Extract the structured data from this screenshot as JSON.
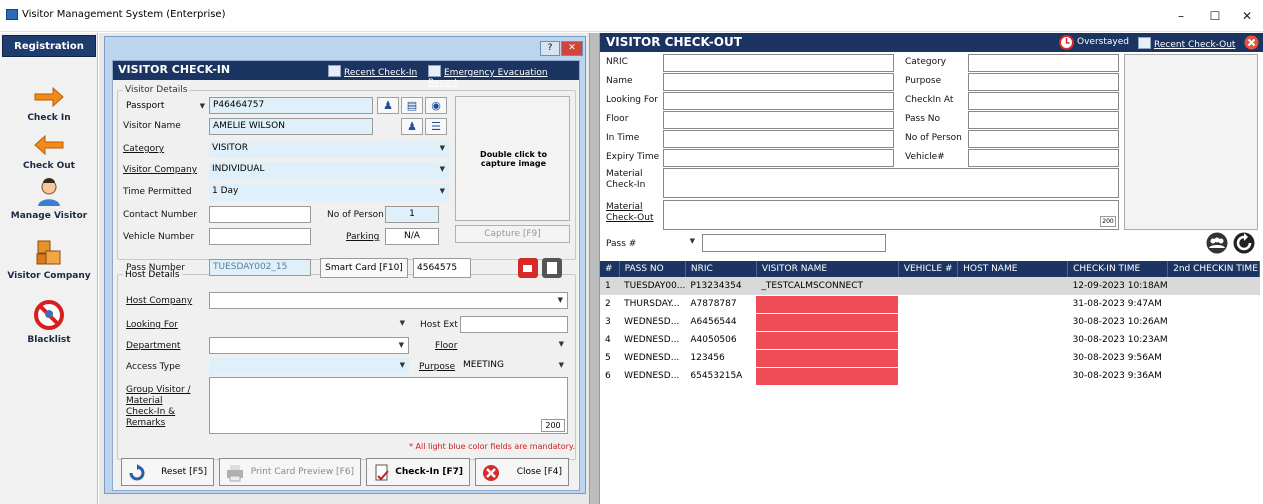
{
  "window": {
    "title": "Visitor Management System (Enterprise)",
    "min": "–",
    "max": "☐",
    "close": "✕"
  },
  "sidebar": {
    "header": "Registration",
    "items": [
      {
        "label": "Check In",
        "icon": "arrow-right-icon"
      },
      {
        "label": "Check Out",
        "icon": "arrow-left-icon"
      },
      {
        "label": "Manage Visitor",
        "icon": "visitor-icon"
      },
      {
        "label": "Visitor Company",
        "icon": "company-boxes-icon"
      },
      {
        "label": "Blacklist",
        "icon": "prohibited-icon"
      }
    ]
  },
  "dialog": {
    "help": "?",
    "close": "✕"
  },
  "checkin": {
    "title": "VISITOR CHECK-IN",
    "recent_link": "Recent Check-In",
    "evac_link": "Emergency Evacuation Report",
    "visitor_details": "Visitor Details",
    "id_type": "Passport",
    "id_value": "P46464757",
    "visitor_name_label": "Visitor Name",
    "visitor_name": "AMELIE WILSON",
    "category_label": "Category",
    "category": "VISITOR",
    "visitor_company_label": "Visitor Company",
    "visitor_company": "INDIVIDUAL",
    "time_permitted_label": "Time Permitted",
    "time_permitted": "1 Day",
    "contact_label": "Contact Number",
    "contact": "",
    "no_person_label": "No of Person",
    "no_person": "1",
    "vehicle_label": "Vehicle Number",
    "vehicle": "",
    "parking_label": "Parking",
    "parking": "N/A",
    "capture_hint": "Double click to capture image",
    "capture_btn": "Capture [F9]",
    "pass_label": "Pass Number",
    "pass_value": "TUESDAY002_15",
    "smart_card_btn": "Smart Card [F10]",
    "smart_card_value": "4564575",
    "host_details": "Host Details",
    "host_company_label": "Host Company",
    "looking_for_label": "Looking For",
    "host_ext_label": "Host Ext",
    "department_label": "Department",
    "floor_label": "Floor",
    "access_type_label": "Access Type",
    "purpose_label": "Purpose",
    "purpose": "MEETING",
    "remarks_label": "Group Visitor / Material Check-In & Remarks",
    "remarks_count": "200",
    "mandatory_note": "* All light blue color fields are mandatory.",
    "btn_reset": "Reset [F5]",
    "btn_print": "Print Card Preview [F6]",
    "btn_checkin": "Check-In [F7]",
    "btn_close": "Close [F4]"
  },
  "checkout": {
    "title": "VISITOR CHECK-OUT",
    "overstayed": "Overstayed",
    "recent_link": "Recent Check-Out",
    "left_labels": [
      "NRIC",
      "Name",
      "Looking For",
      "Floor",
      "In Time",
      "Expiry Time"
    ],
    "right_labels": [
      "Category",
      "Purpose",
      "CheckIn At",
      "Pass No",
      "No of Person",
      "Vehicle#"
    ],
    "material_in": "Material Check-In",
    "material_out": "Material Check-Out",
    "material_count": "200",
    "pass_label": "Pass #"
  },
  "grid": {
    "columns": [
      "#",
      "PASS NO",
      "NRIC",
      "VISITOR NAME",
      "VEHICLE #",
      "HOST NAME",
      "CHECK-IN TIME",
      "2nd CHECKIN TIME"
    ],
    "rows": [
      {
        "n": "1",
        "pass": "TUESDAY00...",
        "nric": "P13234354",
        "name": "_TESTCALMSCONNECT",
        "red": false,
        "time": "12-09-2023 10:18AM"
      },
      {
        "n": "2",
        "pass": "THURSDAY...",
        "nric": "A7878787",
        "name": "",
        "red": true,
        "time": "31-08-2023 9:47AM"
      },
      {
        "n": "3",
        "pass": "WEDNESD...",
        "nric": "A6456544",
        "name": "",
        "red": true,
        "time": "30-08-2023 10:26AM"
      },
      {
        "n": "4",
        "pass": "WEDNESD...",
        "nric": "A4050506",
        "name": "",
        "red": true,
        "time": "30-08-2023 10:23AM"
      },
      {
        "n": "5",
        "pass": "WEDNESD...",
        "nric": "123456",
        "name": "",
        "red": true,
        "time": "30-08-2023 9:56AM"
      },
      {
        "n": "6",
        "pass": "WEDNESD...",
        "nric": "65453215A",
        "name": "",
        "red": true,
        "time": "30-08-2023 9:36AM"
      }
    ]
  },
  "colors": {
    "header": "#1b3461",
    "mandatory": "#dff0fa",
    "overstay": "#ef4c58",
    "accent_orange": "#f28a1a"
  }
}
